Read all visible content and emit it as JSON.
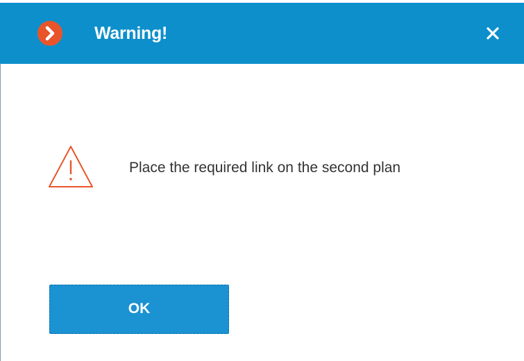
{
  "dialog": {
    "title": "Warning!",
    "message": "Place the required link on the second plan",
    "ok_label": "OK",
    "icons": {
      "app": "app-logo-icon",
      "close": "close-icon",
      "warning": "warning-triangle-icon"
    },
    "colors": {
      "titlebar": "#0d8fcc",
      "app_icon": "#e8552b",
      "warning_icon": "#e8552b",
      "button": "#1b92d2",
      "message_text": "#333333"
    }
  }
}
